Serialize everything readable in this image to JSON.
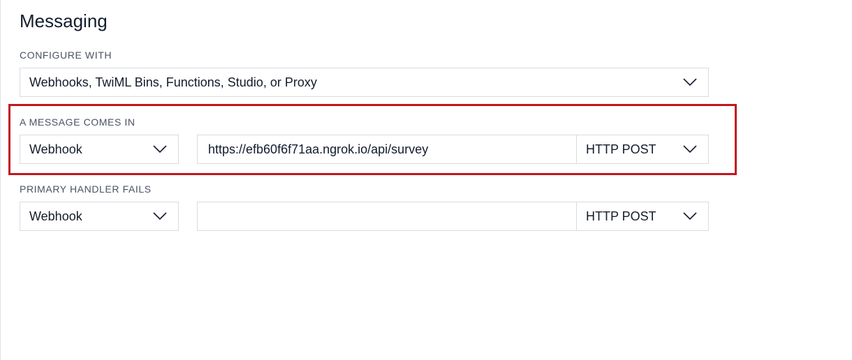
{
  "page": {
    "title": "Messaging"
  },
  "configure_with": {
    "label": "CONFIGURE WITH",
    "selected": "Webhooks, TwiML Bins, Functions, Studio, or Proxy"
  },
  "message_comes_in": {
    "label": "A MESSAGE COMES IN",
    "handler_type": "Webhook",
    "url_value": "https://efb60f6f71aa.ngrok.io/api/survey",
    "http_method": "HTTP POST",
    "highlighted": true,
    "highlight_color": "#c4151c"
  },
  "primary_handler_fails": {
    "label": "PRIMARY HANDLER FAILS",
    "handler_type": "Webhook",
    "url_value": "",
    "http_method": "HTTP POST"
  },
  "icons": {
    "dropdown": "chevron-down-icon"
  }
}
